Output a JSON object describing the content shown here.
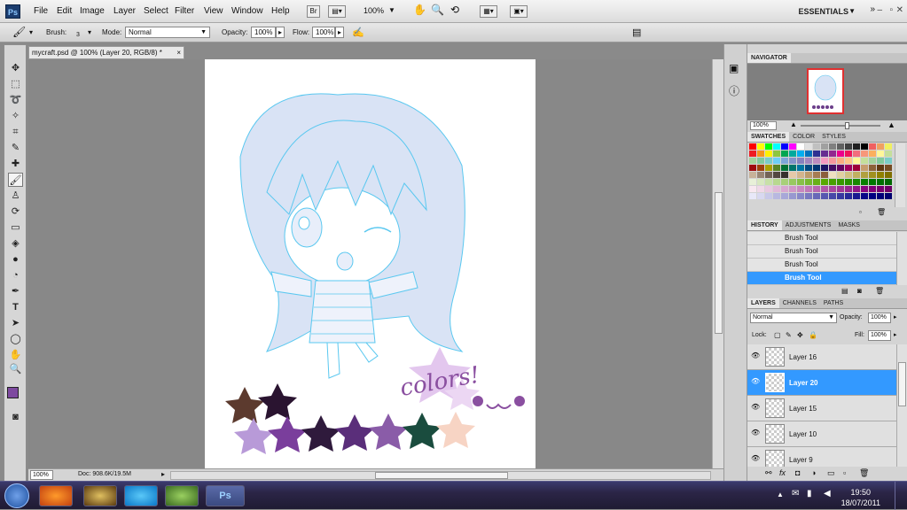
{
  "app": {
    "logo": "Ps",
    "workspace": "ESSENTIALS"
  },
  "menu": [
    "File",
    "Edit",
    "Image",
    "Layer",
    "Select",
    "Filter",
    "View",
    "Window",
    "Help"
  ],
  "toolbar": {
    "br_label": "Br",
    "zoom": "100%"
  },
  "options": {
    "brush_label": "Brush:",
    "brush_size": "3",
    "mode_label": "Mode:",
    "mode_value": "Normal",
    "opacity_label": "Opacity:",
    "opacity_value": "100%",
    "flow_label": "Flow:",
    "flow_value": "100%"
  },
  "document": {
    "tab_title": "mycraft.psd @ 100% (Layer 20, RGB/8) *",
    "close": "×",
    "status_zoom": "100%",
    "status_doc": "Doc: 908.6K/19.5M",
    "canvas_text": "colors!"
  },
  "navigator": {
    "title": "NAVIGATOR",
    "zoom": "100%"
  },
  "swatches": {
    "tabs": [
      "SWATCHES",
      "COLOR",
      "STYLES"
    ],
    "colors": [
      "#ff0000",
      "#ffff00",
      "#00ff00",
      "#00ffff",
      "#0000ff",
      "#ff00ff",
      "#ffffff",
      "#e0e0e0",
      "#c0c0c0",
      "#a0a0a0",
      "#808080",
      "#606060",
      "#404040",
      "#202020",
      "#000000",
      "#f06060",
      "#f0a060",
      "#f0f060",
      "#ee1c24",
      "#f7941d",
      "#fff200",
      "#8dc63f",
      "#00a651",
      "#00a99d",
      "#00aeef",
      "#0072bc",
      "#2e3192",
      "#662d91",
      "#92278f",
      "#ec008c",
      "#ed145b",
      "#f26d7d",
      "#f7977a",
      "#fbaf5d",
      "#fff799",
      "#c4df9b",
      "#a3d39c",
      "#82ca9c",
      "#7accc8",
      "#6dcff6",
      "#7da7d9",
      "#8393ca",
      "#8781bd",
      "#a186be",
      "#bd8cbf",
      "#f49ac1",
      "#f5989d",
      "#f9ad81",
      "#fdc689",
      "#fff79a",
      "#c4df9b",
      "#a2d39c",
      "#82ca9d",
      "#7bcdc8",
      "#9e0b0f",
      "#a0410d",
      "#aba000",
      "#598527",
      "#007236",
      "#00746b",
      "#0076a3",
      "#004a80",
      "#003471",
      "#1b1464",
      "#440e62",
      "#630460",
      "#9e005d",
      "#9e0039",
      "#c69c6d",
      "#8c6239",
      "#603913",
      "#754c24",
      "#c7b299",
      "#998675",
      "#736357",
      "#534741",
      "#362f2d",
      "#e6c9a8",
      "#d2b48c",
      "#bc9a6a",
      "#a67c52",
      "#8b5e3c",
      "#f0e0c0",
      "#e0d0a0",
      "#d0c080",
      "#c0b060",
      "#b0a040",
      "#a09020",
      "#908000",
      "#807000",
      "#e8f0d8",
      "#d8e8c0",
      "#c8e0a8",
      "#b8d890",
      "#a8d078",
      "#98c860",
      "#88c048",
      "#78b830",
      "#68b018",
      "#58a800",
      "#48a000",
      "#389800",
      "#289000",
      "#188800",
      "#088000",
      "#007800",
      "#007000",
      "#006800",
      "#f8e8f0",
      "#f0d8e8",
      "#e8c8e0",
      "#e0b8d8",
      "#d8a8d0",
      "#d098c8",
      "#c888c0",
      "#c078b8",
      "#b868b0",
      "#b058a8",
      "#a848a0",
      "#a03898",
      "#982890",
      "#901888",
      "#880880",
      "#800078",
      "#780070",
      "#700068",
      "#e8e8f8",
      "#d8d8f0",
      "#c8c8e8",
      "#b8b8e0",
      "#a8a8d8",
      "#9898d0",
      "#8888c8",
      "#7878c0",
      "#6868b8",
      "#5858b0",
      "#4848a8",
      "#3838a0",
      "#282898",
      "#181890",
      "#080888",
      "#000080",
      "#000078",
      "#000070",
      "#f8f8e8",
      "#f0f0d8",
      "#e8e8c8",
      "#e0e0b8",
      "#d8d8a8",
      "#d0d098",
      "#c8c888",
      "#c0c078",
      "#b8b868",
      "#b0b058",
      "#a8a848",
      "#a0a038",
      "#989828",
      "#909018",
      "#888808",
      "#808000",
      "#787800",
      "#707000"
    ]
  },
  "history": {
    "tabs": [
      "HISTORY",
      "ADJUSTMENTS",
      "MASKS"
    ],
    "items": [
      "Brush Tool",
      "Brush Tool",
      "Brush Tool",
      "Brush Tool"
    ]
  },
  "layers": {
    "tabs": [
      "LAYERS",
      "CHANNELS",
      "PATHS"
    ],
    "blend": "Normal",
    "opacity_label": "Opacity:",
    "opacity_value": "100%",
    "lock_label": "Lock:",
    "fill_label": "Fill:",
    "fill_value": "100%",
    "items": [
      "Layer 16",
      "Layer 20",
      "Layer 15",
      "Layer 10",
      "Layer 9"
    ]
  },
  "taskbar": {
    "time": "19:50",
    "date": "18/07/2011",
    "ps_label": "Ps"
  },
  "colors": {
    "accent": "#3399ff",
    "fg_swatch": "#7e4aa0"
  }
}
